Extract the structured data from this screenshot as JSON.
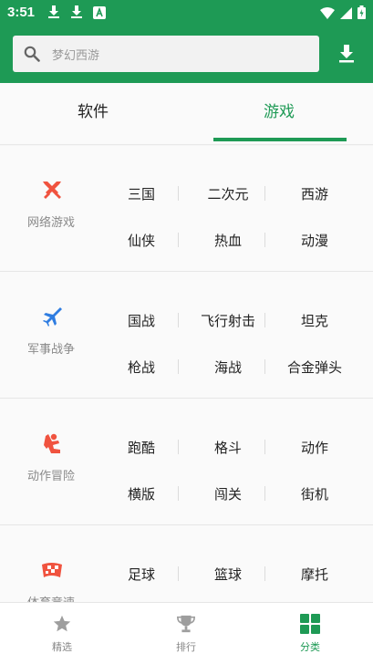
{
  "status_bar": {
    "time": "3:51"
  },
  "search": {
    "placeholder": "梦幻西游"
  },
  "tabs": [
    {
      "label": "软件",
      "active": false
    },
    {
      "label": "游戏",
      "active": true
    }
  ],
  "categories": [
    {
      "name": "网络游戏",
      "icon": "swords-icon",
      "tags": [
        "三国",
        "二次元",
        "西游",
        "仙侠",
        "热血",
        "动漫"
      ]
    },
    {
      "name": "军事战争",
      "icon": "jet-icon",
      "tags": [
        "国战",
        "飞行射击",
        "坦克",
        "枪战",
        "海战",
        "合金弹头"
      ]
    },
    {
      "name": "动作冒险",
      "icon": "kick-icon",
      "tags": [
        "跑酷",
        "格斗",
        "动作",
        "横版",
        "闯关",
        "街机"
      ]
    },
    {
      "name": "体育竞速",
      "icon": "checkered-flag-icon",
      "tags": [
        "足球",
        "篮球",
        "摩托"
      ]
    }
  ],
  "bottom_nav": [
    {
      "label": "精选",
      "icon": "star-icon",
      "active": false
    },
    {
      "label": "排行",
      "icon": "trophy-icon",
      "active": false
    },
    {
      "label": "分类",
      "icon": "grid-icon",
      "active": true
    }
  ],
  "colors": {
    "brand": "#1e9a55",
    "category_icon": "#f0533f",
    "military_icon": "#2f7de1"
  }
}
